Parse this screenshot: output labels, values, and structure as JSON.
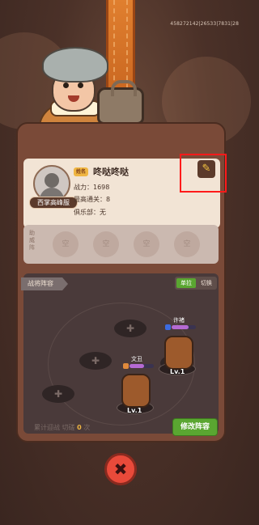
{
  "debug_id": "458272142|26533|7831|28",
  "profile": {
    "title_badge": "西掌高峰服",
    "nickname_tag": "姓名",
    "nickname": "咚哒咚哒",
    "stats": {
      "power": "战力：1698",
      "highest_stage": "最高通关：8",
      "club": "俱乐部：无"
    },
    "edit_icon": "quill-icon"
  },
  "support": {
    "label": "助威阵",
    "slots": [
      "空",
      "空",
      "空",
      "空"
    ]
  },
  "formation": {
    "title": "战将阵容",
    "toggle": {
      "on": "单拉",
      "off": "切换"
    },
    "empty_positions": [
      {
        "label": "✚"
      },
      {
        "label": "✚"
      },
      {
        "label": "✚"
      },
      {
        "label": "✚"
      }
    ],
    "heroes": [
      {
        "name": "许褚",
        "level": "Lv.1",
        "tag_color": "#3c6be0",
        "hp": 0.7
      },
      {
        "name": "文丑",
        "level": "Lv.1",
        "tag_color": "#e08a3c",
        "hp": 0.6
      }
    ],
    "win_streak_label": "累计迎战 切磋",
    "win_streak_value": "0",
    "win_streak_unit": "次",
    "modify_button": "修改阵容"
  },
  "close_button": "✖",
  "colors": {
    "accent_green": "#5aa631",
    "close_red": "#e84a3a",
    "highlight": "#ff1a1a"
  }
}
